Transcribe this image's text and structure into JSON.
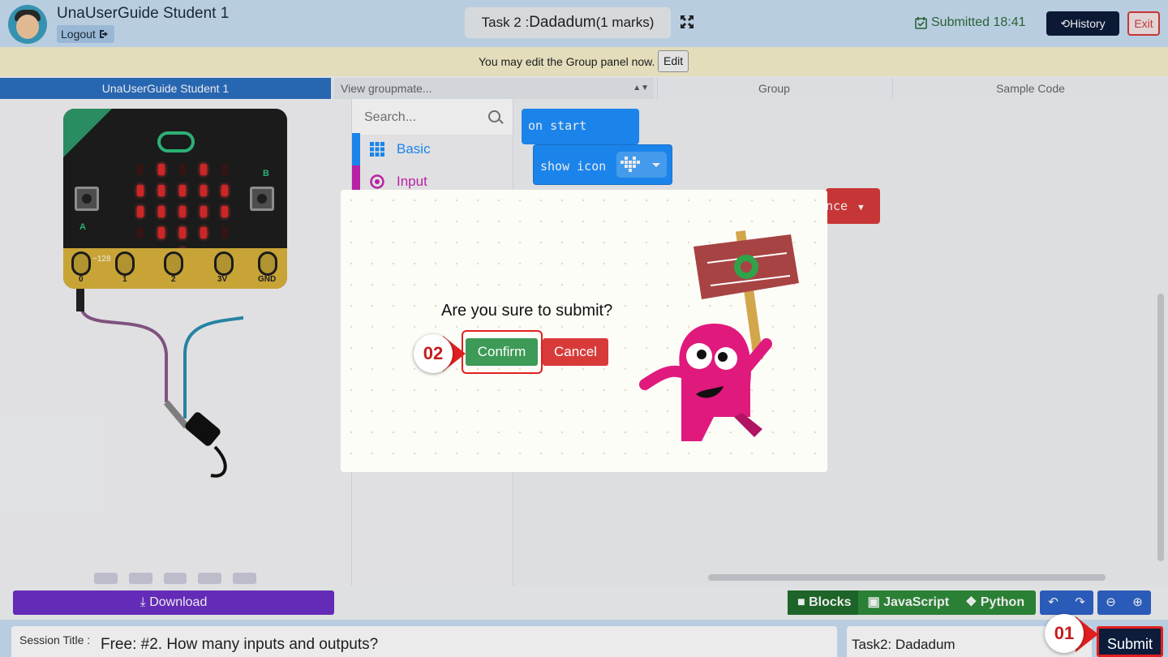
{
  "header": {
    "user_name": "UnaUserGuide Student 1",
    "logout_label": "Logout",
    "task_title_prefix": "Task 2 :",
    "task_title_name": "Dadadum",
    "task_title_marks": "(1 marks)",
    "submitted_text": "Submitted 18:41",
    "history_label": "History",
    "exit_label": "Exit"
  },
  "notice": {
    "text": "You may edit the Group panel now.",
    "edit_label": "Edit"
  },
  "tabs": {
    "student": "UnaUserGuide Student 1",
    "view_groupmate": "View groupmate...",
    "group": "Group",
    "sample_code": "Sample Code"
  },
  "simulator": {
    "pin_labels": [
      "0",
      "1",
      "2",
      "3V",
      "GND"
    ],
    "pin0_value": "~128",
    "button_a": "A",
    "button_b": "B",
    "led_matrix": [
      [
        0,
        1,
        0,
        1,
        0
      ],
      [
        1,
        1,
        1,
        1,
        1
      ],
      [
        1,
        1,
        1,
        1,
        1
      ],
      [
        0,
        1,
        1,
        1,
        0
      ],
      [
        0,
        0,
        1,
        0,
        0
      ]
    ],
    "download_label": "Download"
  },
  "toolbox": {
    "search_placeholder": "Search...",
    "categories": [
      {
        "label": "Basic",
        "color": "#1e90ff"
      },
      {
        "label": "Input",
        "color": "#c724b1"
      }
    ]
  },
  "workspace": {
    "on_start": "on start",
    "show_icon": "show icon",
    "red_block_fragment": "nce"
  },
  "editor": {
    "blocks_label": "Blocks",
    "javascript_label": "JavaScript",
    "python_label": "Python"
  },
  "bottom": {
    "session_label": "Session Title :",
    "session_title": "Free: #2. How many inputs and outputs?",
    "task_name": "Task2: Dadadum",
    "submit_label": "Submit",
    "marker_01": "01"
  },
  "modal": {
    "question": "Are you sure to submit?",
    "confirm_label": "Confirm",
    "cancel_label": "Cancel",
    "marker_02": "02"
  },
  "colors": {
    "header_bg": "#c9dff4",
    "notice_bg": "#f7f0cc",
    "student_tab": "#2b6fc0",
    "download": "#6c2fc7",
    "confirm": "#3d9a57",
    "cancel": "#d83a3a",
    "submit": "#0c1c3a",
    "marker_red": "#e02020"
  }
}
